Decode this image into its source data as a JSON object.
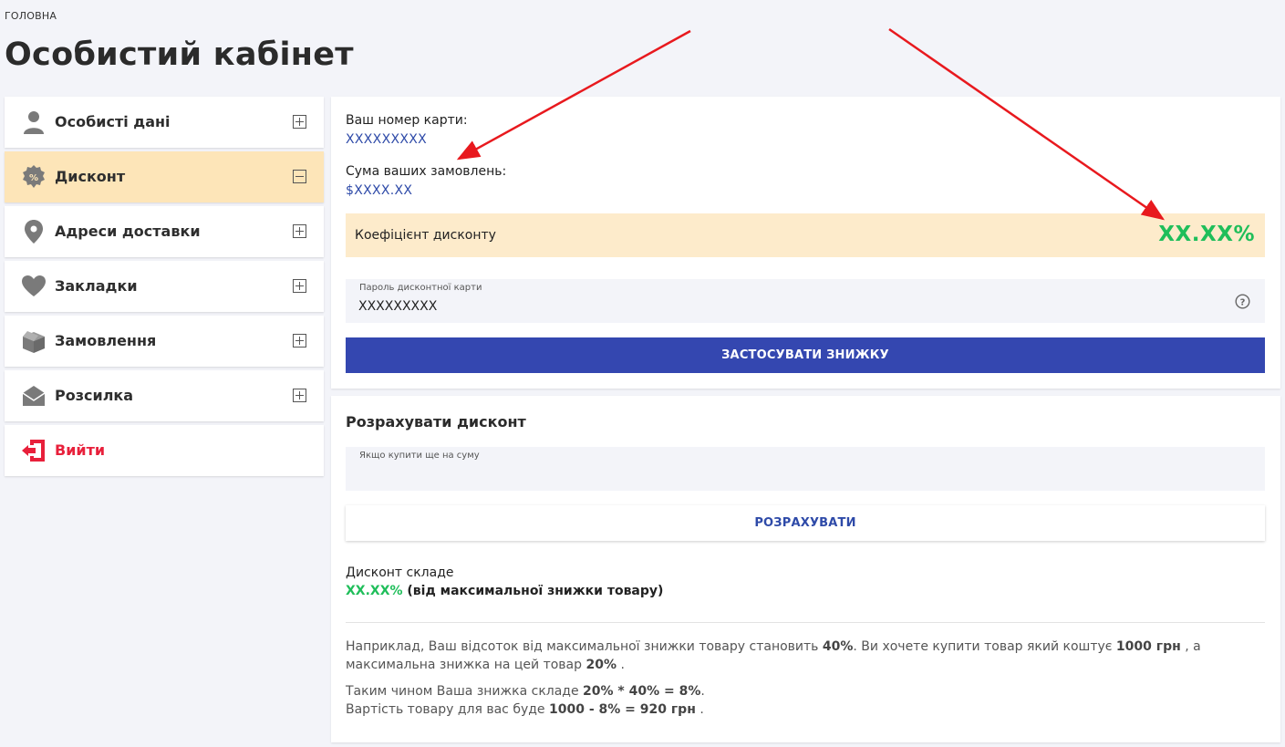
{
  "breadcrumb": "ГОЛОВНА",
  "page_title": "Особистий кабінет",
  "colors": {
    "primary": "#3447b0",
    "accent_green": "#1fbe5a",
    "active_bg": "#fde5b8",
    "logout_red": "#e8203b",
    "annotation_arrow": "#e8191e"
  },
  "sidebar": {
    "items": [
      {
        "label": "Особисті дані",
        "icon": "user-icon",
        "expanded": false
      },
      {
        "label": "Дисконт",
        "icon": "percent-badge-icon",
        "expanded": true
      },
      {
        "label": "Адреси доставки",
        "icon": "map-pin-icon",
        "expanded": false
      },
      {
        "label": "Закладки",
        "icon": "heart-icon",
        "expanded": false
      },
      {
        "label": "Замовлення",
        "icon": "box-icon",
        "expanded": false
      },
      {
        "label": "Розсилка",
        "icon": "envelope-icon",
        "expanded": false
      },
      {
        "label": "Вийти",
        "icon": "logout-icon"
      }
    ]
  },
  "discount": {
    "card_number_label": "Ваш номер карти:",
    "card_number": "XXXXXXXXX",
    "orders_sum_label": "Сума ваших замовлень:",
    "orders_sum": "$XXXX.XX",
    "coefficient_label": "Коефіцієнт дисконту",
    "coefficient_value": "XX.XX%",
    "password_label": "Пароль дисконтної карти",
    "password_value": "XXXXXXXXX",
    "apply_button": "ЗАСТОСУВАТИ ЗНИЖКУ"
  },
  "calculator": {
    "title": "Розрахувати дисконт",
    "amount_label": "Якщо купити ще на суму",
    "amount_value": "",
    "calculate_button": "РОЗРАХУВАТИ",
    "result_label": "Дисконт складе",
    "result_value": "XX.XX%",
    "result_suffix": " (від максимальної знижки товару)",
    "example": {
      "p1_a": "Наприклад, Ваш відсоток від максимальної знижки товару становить ",
      "p1_b": "40%",
      "p1_c": ". Ви хочете купити товар який коштує ",
      "p1_d": "1000 грн",
      "p1_e": " , а максимальна знижка на цей товар ",
      "p1_f": "20%",
      "p1_g": " .",
      "p2_a": "Таким чином Ваша знижка складе ",
      "p2_b": "20% * 40% = 8%",
      "p2_c": ".",
      "p3_a": "Вартість товару для вас буде ",
      "p3_b": "1000 - 8% = 920 грн",
      "p3_c": " ."
    }
  }
}
